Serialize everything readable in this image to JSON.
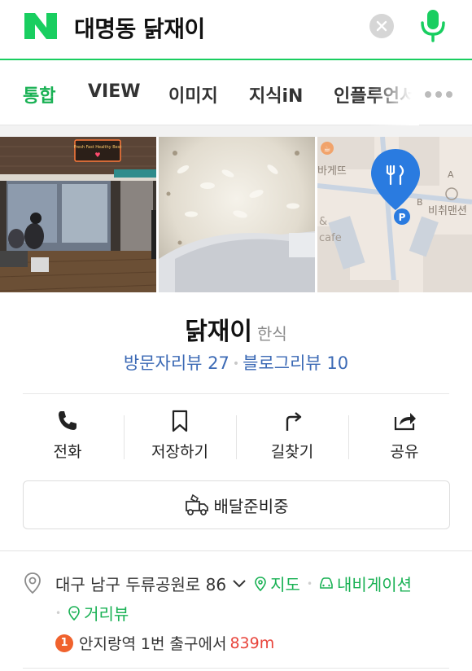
{
  "search": {
    "query": "대명동 닭재이"
  },
  "tabs": [
    {
      "label": "통합",
      "active": true
    },
    {
      "label": "VIEW"
    },
    {
      "label": "이미지"
    },
    {
      "label": "지식iN"
    },
    {
      "label": "인플루언서"
    }
  ],
  "photos": [
    {
      "name": "restaurant-interior-photo",
      "sign_text": "Fresh Fast Healthy Best"
    },
    {
      "name": "rice-food-photo"
    },
    {
      "name": "map-thumbnail",
      "labels": [
        "바게뜨",
        "비취맨션",
        "cafe",
        "A",
        "B",
        "P"
      ]
    }
  ],
  "place": {
    "name": "닭재이",
    "category": "한식",
    "visitor_reviews": "방문자리뷰 27",
    "blog_reviews": "블로그리뷰 10"
  },
  "actions": [
    {
      "label": "전화",
      "icon": "phone-icon"
    },
    {
      "label": "저장하기",
      "icon": "bookmark-icon"
    },
    {
      "label": "길찾기",
      "icon": "directions-icon"
    },
    {
      "label": "공유",
      "icon": "share-icon"
    }
  ],
  "delivery": {
    "label": "배달준비중"
  },
  "address": {
    "text": "대구 남구 두류공원로 86",
    "map_link": "지도",
    "navigation_link": "내비게이션",
    "street_view_link": "거리뷰"
  },
  "subway": {
    "line_number": "1",
    "station": "안지랑역",
    "exit": "1번 출구에서",
    "distance": "839m"
  },
  "colors": {
    "brand_green": "#19ce60",
    "link_blue": "#3c6ab5",
    "subway_orange": "#f0622d",
    "distance_red": "#e8453c"
  }
}
